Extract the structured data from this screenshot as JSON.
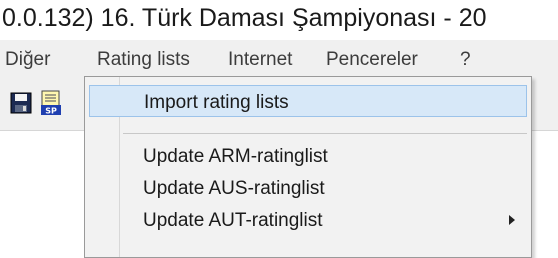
{
  "window": {
    "title": "0.0.132)  16. Türk Daması Şampiyonası - 20"
  },
  "menubar": {
    "items": [
      {
        "label": "Diğer"
      },
      {
        "label": "Rating lists"
      },
      {
        "label": "Internet"
      },
      {
        "label": "Pencereler"
      },
      {
        "label": "?"
      }
    ]
  },
  "toolbar": {
    "buttons": [
      {
        "icon": "save-icon"
      },
      {
        "icon": "sp-document-icon"
      }
    ]
  },
  "dropdown": {
    "items": [
      {
        "label": "Import rating lists",
        "selected": true,
        "submenu": false
      },
      {
        "label": "Update ARM-ratinglist",
        "selected": false,
        "submenu": false
      },
      {
        "label": "Update AUS-ratinglist",
        "selected": false,
        "submenu": false
      },
      {
        "label": "Update AUT-ratinglist",
        "selected": false,
        "submenu": true
      }
    ]
  },
  "colors": {
    "menu_bg": "#f0f0f0",
    "highlight": "#d7e8f8",
    "highlight_border": "#9cc3ea"
  }
}
